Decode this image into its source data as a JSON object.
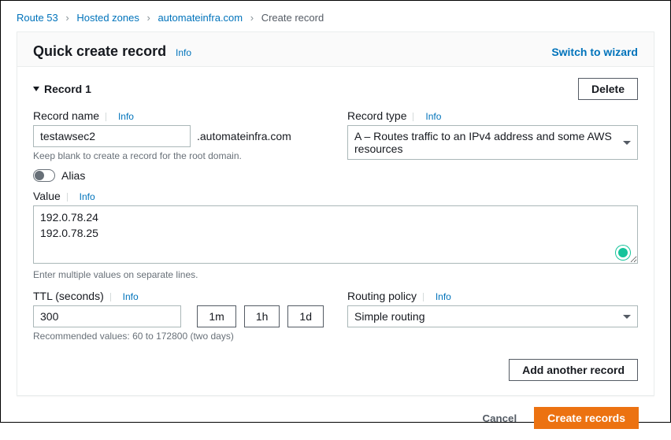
{
  "breadcrumb": {
    "items": [
      "Route 53",
      "Hosted zones",
      "automateinfra.com"
    ],
    "current": "Create record"
  },
  "header": {
    "title": "Quick create record",
    "info": "Info",
    "switch": "Switch to wizard"
  },
  "record": {
    "title": "Record 1",
    "delete": "Delete",
    "name": {
      "label": "Record name",
      "info": "Info",
      "value": "testawsec2",
      "suffix": ".automateinfra.com",
      "hint": "Keep blank to create a record for the root domain."
    },
    "type": {
      "label": "Record type",
      "info": "Info",
      "selected": "A – Routes traffic to an IPv4 address and some AWS resources"
    },
    "alias": {
      "label": "Alias",
      "on": false
    },
    "value": {
      "label": "Value",
      "info": "Info",
      "text": "192.0.78.24\n192.0.78.25",
      "hint": "Enter multiple values on separate lines."
    },
    "ttl": {
      "label": "TTL (seconds)",
      "info": "Info",
      "value": "300",
      "presets": [
        "1m",
        "1h",
        "1d"
      ],
      "hint": "Recommended values: 60 to 172800 (two days)"
    },
    "routing": {
      "label": "Routing policy",
      "info": "Info",
      "selected": "Simple routing"
    },
    "add_another": "Add another record"
  },
  "footer": {
    "cancel": "Cancel",
    "create": "Create records"
  }
}
